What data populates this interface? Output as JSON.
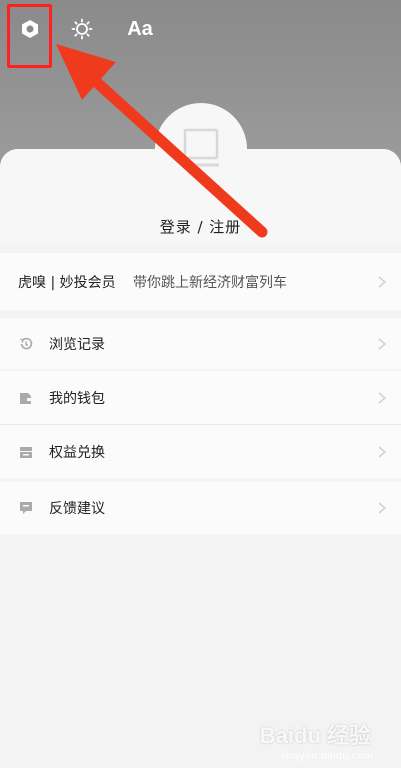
{
  "topbar": {
    "settings_icon": "gear-hexagon-icon",
    "brightness_icon": "sun-icon",
    "font_label": "Aa"
  },
  "profile": {
    "login_text": "登录 / 注册",
    "avatar_icon": "default-avatar-icon"
  },
  "membership": {
    "title": "虎嗅 | 妙投会员",
    "desc": "带你跳上新经济财富列车"
  },
  "menu": {
    "history": "浏览记录",
    "wallet": "我的钱包",
    "redeem": "权益兑换",
    "feedback": "反馈建议"
  },
  "watermark": {
    "brand": "Baidu 经验",
    "url": "jingyan.baidu.com"
  },
  "colors": {
    "annotation_red": "#ff2020",
    "sheet_bg": "#f3f3f3",
    "row_bg": "#fbfbfb"
  }
}
